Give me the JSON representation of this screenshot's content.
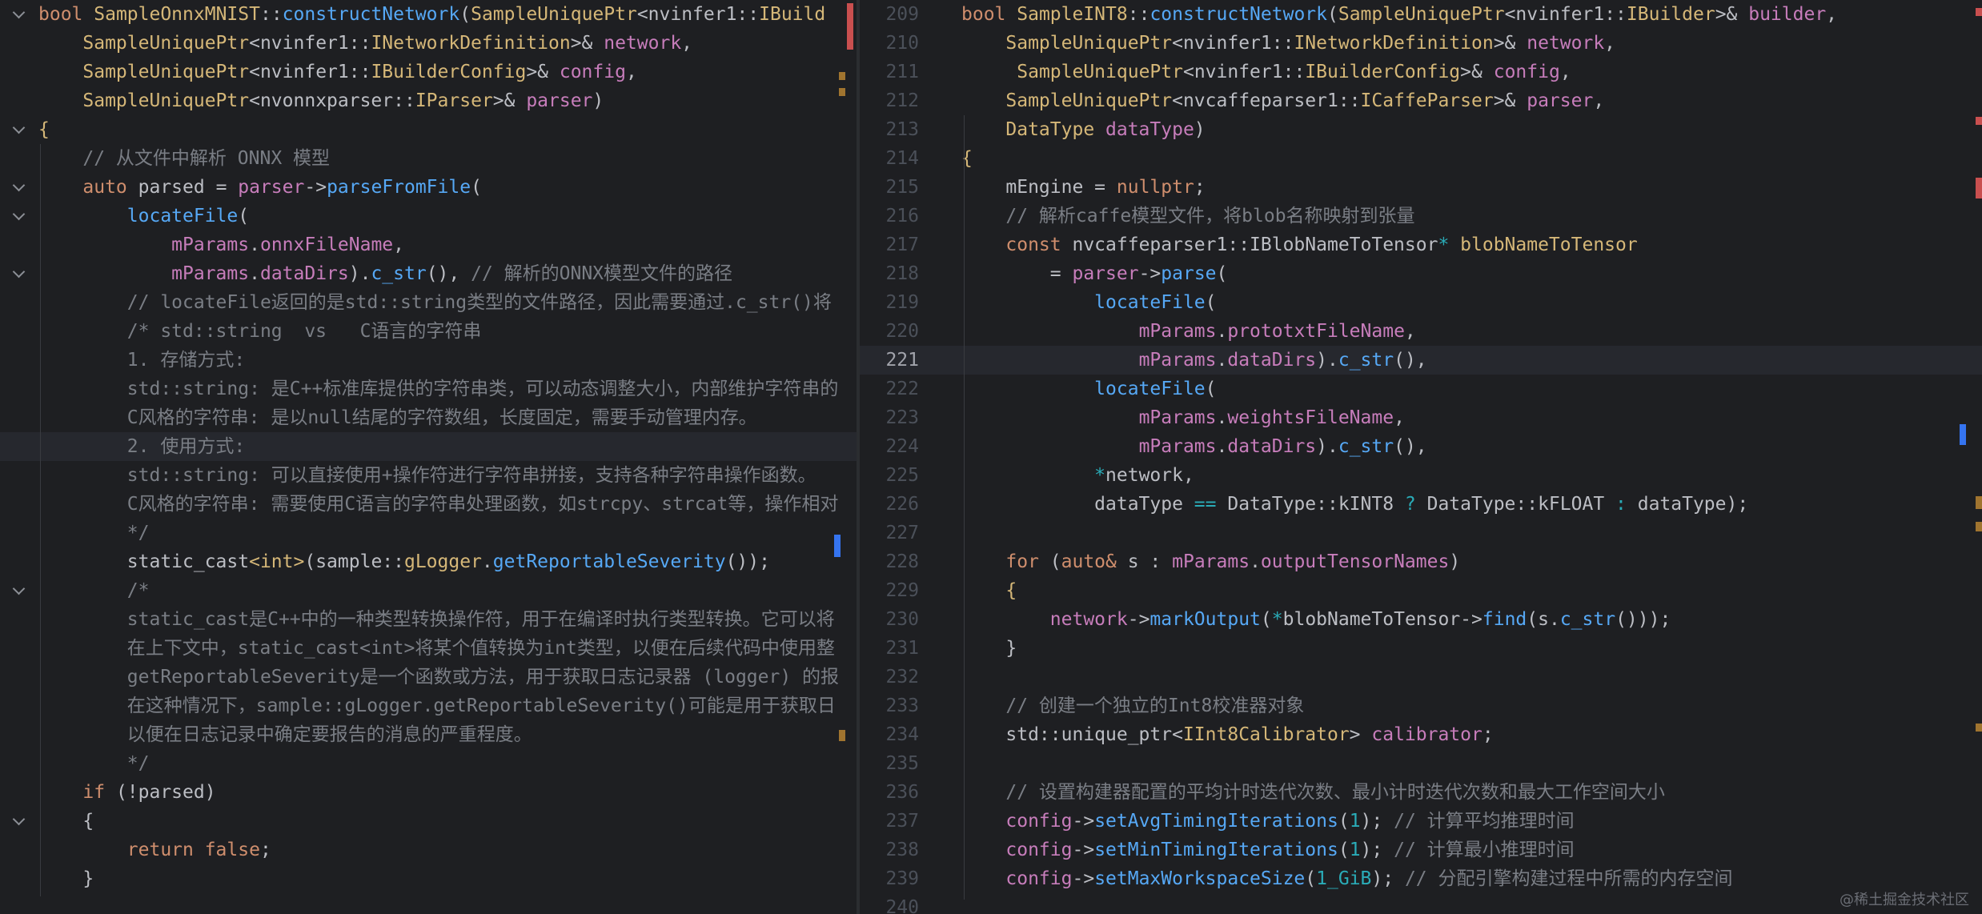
{
  "left_editor": {
    "lines": [
      {
        "fold": true,
        "indent": 0,
        "tokens": [
          [
            "kw",
            "bool "
          ],
          [
            "ty",
            "SampleOnnxMNIST"
          ],
          [
            "pl",
            "::"
          ],
          [
            "fn",
            "constructNetwork"
          ],
          [
            "pl",
            "("
          ],
          [
            "ty",
            "SampleUniquePtr"
          ],
          [
            "pl",
            "<nvinfer1::"
          ],
          [
            "ty",
            "IBuild"
          ]
        ]
      },
      {
        "indent": 1,
        "tokens": [
          [
            "ty",
            "SampleUniquePtr"
          ],
          [
            "pl",
            "<nvinfer1::"
          ],
          [
            "ty",
            "INetworkDefinition"
          ],
          [
            "pl",
            ">& "
          ],
          [
            "vr",
            "network"
          ],
          [
            "pl",
            ","
          ]
        ]
      },
      {
        "indent": 1,
        "tokens": [
          [
            "ty",
            "SampleUniquePtr"
          ],
          [
            "pl",
            "<nvinfer1::"
          ],
          [
            "ty",
            "IBuilderConfig"
          ],
          [
            "pl",
            ">& "
          ],
          [
            "vr",
            "config"
          ],
          [
            "pl",
            ","
          ]
        ]
      },
      {
        "indent": 1,
        "tokens": [
          [
            "ty",
            "SampleUniquePtr"
          ],
          [
            "pl",
            "<nvonnxparser::"
          ],
          [
            "ty",
            "IParser"
          ],
          [
            "pl",
            ">& "
          ],
          [
            "vr",
            "parser"
          ],
          [
            "pl",
            ")"
          ]
        ]
      },
      {
        "fold": true,
        "indent": 0,
        "tokens": [
          [
            "ty",
            "{"
          ]
        ]
      },
      {
        "indent": 1,
        "tokens": [
          [
            "cm",
            "// 从文件中解析 ONNX 模型"
          ]
        ]
      },
      {
        "fold": true,
        "indent": 1,
        "tokens": [
          [
            "kw",
            "auto "
          ],
          [
            "pl",
            "parsed = "
          ],
          [
            "vr",
            "parser"
          ],
          [
            "pl",
            "->"
          ],
          [
            "fn",
            "parseFromFile"
          ],
          [
            "pl",
            "("
          ]
        ]
      },
      {
        "fold": true,
        "indent": 2,
        "tokens": [
          [
            "fn",
            "locateFile"
          ],
          [
            "pl",
            "("
          ]
        ]
      },
      {
        "indent": 3,
        "tokens": [
          [
            "fd",
            "mParams"
          ],
          [
            "pl",
            "."
          ],
          [
            "fd",
            "onnxFileName"
          ],
          [
            "pl",
            ","
          ]
        ]
      },
      {
        "fold": true,
        "indent": 3,
        "tokens": [
          [
            "fd",
            "mParams"
          ],
          [
            "pl",
            "."
          ],
          [
            "fd",
            "dataDirs"
          ],
          [
            "pl",
            ")."
          ],
          [
            "fn",
            "c_str"
          ],
          [
            "pl",
            "(), "
          ],
          [
            "cm",
            "// 解析的ONNX模型文件的路径"
          ]
        ]
      },
      {
        "indent": 2,
        "tokens": [
          [
            "cm",
            "// locateFile返回的是std::string类型的文件路径，因此需要通过.c_str()将"
          ]
        ]
      },
      {
        "indent": 2,
        "tokens": [
          [
            "cm",
            "/* std::string  vs   C语言的字符串"
          ]
        ]
      },
      {
        "indent": 2,
        "tokens": [
          [
            "cm",
            "1. 存储方式:"
          ]
        ]
      },
      {
        "indent": 2,
        "tokens": [
          [
            "cm",
            "std::string: 是C++标准库提供的字符串类，可以动态调整大小，内部维护字符串的"
          ]
        ]
      },
      {
        "indent": 2,
        "tokens": [
          [
            "cm",
            "C风格的字符串: 是以null结尾的字符数组，长度固定，需要手动管理内存。"
          ]
        ]
      },
      {
        "indent": 2,
        "current": true,
        "tokens": [
          [
            "cm",
            "2. 使用方式:"
          ]
        ]
      },
      {
        "indent": 2,
        "tokens": [
          [
            "cm",
            "std::string: 可以直接使用+操作符进行字符串拼接，支持各种字符串操作函数。"
          ]
        ]
      },
      {
        "indent": 2,
        "tokens": [
          [
            "cm",
            "C风格的字符串: 需要使用C语言的字符串处理函数，如strcpy、strcat等，操作相对"
          ]
        ]
      },
      {
        "indent": 2,
        "tokens": [
          [
            "cm",
            "*/"
          ]
        ]
      },
      {
        "indent": 2,
        "tokens": [
          [
            "pl",
            "static_cast"
          ],
          [
            "ty",
            "<int>"
          ],
          [
            "pl",
            "(sample::"
          ],
          [
            "ty",
            "gLogger"
          ],
          [
            "pl",
            "."
          ],
          [
            "fn",
            "getReportableSeverity"
          ],
          [
            "pl",
            "());"
          ]
        ]
      },
      {
        "fold": true,
        "indent": 2,
        "tokens": [
          [
            "cm",
            "/*"
          ]
        ]
      },
      {
        "indent": 2,
        "tokens": [
          [
            "cm",
            "static_cast是C++中的一种类型转换操作符，用于在编译时执行类型转换。它可以将"
          ]
        ]
      },
      {
        "indent": 2,
        "tokens": [
          [
            "cm",
            "在上下文中，static_cast<int>将某个值转换为int类型，以便在后续代码中使用整"
          ]
        ]
      },
      {
        "indent": 2,
        "tokens": [
          [
            "cm",
            "getReportableSeverity是一个函数或方法，用于获取日志记录器 (logger) 的报"
          ]
        ]
      },
      {
        "indent": 2,
        "tokens": [
          [
            "cm",
            "在这种情况下，sample::gLogger.getReportableSeverity()可能是用于获取日"
          ]
        ]
      },
      {
        "indent": 2,
        "tokens": [
          [
            "cm",
            "以便在日志记录中确定要报告的消息的严重程度。"
          ]
        ]
      },
      {
        "indent": 2,
        "tokens": [
          [
            "cm",
            "*/"
          ]
        ]
      },
      {
        "indent": 1,
        "tokens": [
          [
            "kw",
            "if "
          ],
          [
            "pl",
            "(!parsed)"
          ]
        ]
      },
      {
        "fold": true,
        "indent": 1,
        "tokens": [
          [
            "pl",
            "{"
          ]
        ]
      },
      {
        "indent": 2,
        "tokens": [
          [
            "kw",
            "return false"
          ],
          [
            "pl",
            ";"
          ]
        ]
      },
      {
        "indent": 1,
        "tokens": [
          [
            "pl",
            "}"
          ]
        ]
      }
    ]
  },
  "right_editor": {
    "lines": [
      {
        "num": "209",
        "indent": 0,
        "tokens": [
          [
            "kw",
            "bool "
          ],
          [
            "ty",
            "SampleINT8"
          ],
          [
            "pl",
            "::"
          ],
          [
            "fn",
            "constructNetwork"
          ],
          [
            "pl",
            "("
          ],
          [
            "ty",
            "SampleUniquePtr"
          ],
          [
            "pl",
            "<nvinfer1::"
          ],
          [
            "ty",
            "IBuilder"
          ],
          [
            "pl",
            ">& "
          ],
          [
            "vr",
            "builder"
          ],
          [
            "pl",
            ","
          ]
        ]
      },
      {
        "num": "210",
        "indent": 1,
        "tokens": [
          [
            "ty",
            "SampleUniquePtr"
          ],
          [
            "pl",
            "<nvinfer1::"
          ],
          [
            "ty",
            "INetworkDefinition"
          ],
          [
            "pl",
            ">& "
          ],
          [
            "vr",
            "network"
          ],
          [
            "pl",
            ","
          ]
        ]
      },
      {
        "num": "211",
        "indent": 1,
        "tokens": [
          [
            "pl",
            " "
          ],
          [
            "ty",
            "SampleUniquePtr"
          ],
          [
            "pl",
            "<nvinfer1::"
          ],
          [
            "ty",
            "IBuilderConfig"
          ],
          [
            "pl",
            ">& "
          ],
          [
            "vr",
            "config"
          ],
          [
            "pl",
            ","
          ]
        ]
      },
      {
        "num": "212",
        "indent": 1,
        "tokens": [
          [
            "ty",
            "SampleUniquePtr"
          ],
          [
            "pl",
            "<nvcaffeparser1::"
          ],
          [
            "ty",
            "ICaffeParser"
          ],
          [
            "pl",
            ">& "
          ],
          [
            "vr",
            "parser"
          ],
          [
            "pl",
            ","
          ]
        ]
      },
      {
        "num": "213",
        "indent": 1,
        "tokens": [
          [
            "ty",
            "DataType "
          ],
          [
            "vr",
            "dataType"
          ],
          [
            "pl",
            ")"
          ]
        ]
      },
      {
        "num": "214",
        "indent": 0,
        "tokens": [
          [
            "ty",
            "{"
          ]
        ]
      },
      {
        "num": "215",
        "indent": 1,
        "tokens": [
          [
            "pl",
            "mEngine = "
          ],
          [
            "kw",
            "nullptr"
          ],
          [
            "pl",
            ";"
          ]
        ]
      },
      {
        "num": "216",
        "indent": 1,
        "tokens": [
          [
            "cm",
            "// 解析caffe模型文件，将blob名称映射到张量"
          ]
        ]
      },
      {
        "num": "217",
        "indent": 1,
        "tokens": [
          [
            "kw",
            "const "
          ],
          [
            "pl",
            "nvcaffeparser1::IBlobNameToTensor"
          ],
          [
            "nu",
            "* "
          ],
          [
            "ty",
            "blobNameToTensor"
          ]
        ]
      },
      {
        "num": "218",
        "indent": 2,
        "tokens": [
          [
            "pl",
            "= "
          ],
          [
            "vr",
            "parser"
          ],
          [
            "pl",
            "->"
          ],
          [
            "fn",
            "parse"
          ],
          [
            "pl",
            "("
          ]
        ]
      },
      {
        "num": "219",
        "indent": 3,
        "tokens": [
          [
            "fn",
            "locateFile"
          ],
          [
            "pl",
            "("
          ]
        ]
      },
      {
        "num": "220",
        "indent": 4,
        "tokens": [
          [
            "fd",
            "mParams"
          ],
          [
            "pl",
            "."
          ],
          [
            "fd",
            "prototxtFileName"
          ],
          [
            "pl",
            ","
          ]
        ]
      },
      {
        "num": "221",
        "indent": 4,
        "current": true,
        "tokens": [
          [
            "fd",
            "mParams"
          ],
          [
            "pl",
            "."
          ],
          [
            "fd",
            "dataDirs"
          ],
          [
            "pl",
            ")."
          ],
          [
            "fn",
            "c_str"
          ],
          [
            "pl",
            "(),"
          ]
        ]
      },
      {
        "num": "222",
        "indent": 3,
        "tokens": [
          [
            "fn",
            "locateFile"
          ],
          [
            "pl",
            "("
          ]
        ]
      },
      {
        "num": "223",
        "indent": 4,
        "tokens": [
          [
            "fd",
            "mParams"
          ],
          [
            "pl",
            "."
          ],
          [
            "fd",
            "weightsFileName"
          ],
          [
            "pl",
            ","
          ]
        ]
      },
      {
        "num": "224",
        "indent": 4,
        "tokens": [
          [
            "fd",
            "mParams"
          ],
          [
            "pl",
            "."
          ],
          [
            "fd",
            "dataDirs"
          ],
          [
            "pl",
            ")."
          ],
          [
            "fn",
            "c_str"
          ],
          [
            "pl",
            "(),"
          ]
        ]
      },
      {
        "num": "225",
        "indent": 3,
        "tokens": [
          [
            "nu",
            "*"
          ],
          [
            "pl",
            "network,"
          ]
        ]
      },
      {
        "num": "226",
        "indent": 3,
        "tokens": [
          [
            "pl",
            "dataType "
          ],
          [
            "nu",
            "=="
          ],
          [
            "pl",
            " DataType::kINT8 "
          ],
          [
            "nu",
            "?"
          ],
          [
            "pl",
            " DataType::kFLOAT "
          ],
          [
            "nu",
            ":"
          ],
          [
            "pl",
            " dataType);"
          ]
        ]
      },
      {
        "num": "227",
        "indent": 0,
        "tokens": []
      },
      {
        "num": "228",
        "indent": 1,
        "tokens": [
          [
            "kw",
            "for "
          ],
          [
            "pl",
            "("
          ],
          [
            "kw",
            "auto& "
          ],
          [
            "pl",
            "s : "
          ],
          [
            "fd",
            "mParams"
          ],
          [
            "pl",
            "."
          ],
          [
            "fd",
            "outputTensorNames"
          ],
          [
            "pl",
            ")"
          ]
        ]
      },
      {
        "num": "229",
        "indent": 1,
        "tokens": [
          [
            "ty",
            "{"
          ]
        ]
      },
      {
        "num": "230",
        "indent": 2,
        "tokens": [
          [
            "vr",
            "network"
          ],
          [
            "pl",
            "->"
          ],
          [
            "fn",
            "markOutput"
          ],
          [
            "pl",
            "("
          ],
          [
            "nu",
            "*"
          ],
          [
            "pl",
            "blobNameToTensor->"
          ],
          [
            "fn",
            "find"
          ],
          [
            "pl",
            "(s."
          ],
          [
            "fn",
            "c_str"
          ],
          [
            "pl",
            "()));"
          ]
        ]
      },
      {
        "num": "231",
        "indent": 1,
        "tokens": [
          [
            "pl",
            "}"
          ]
        ]
      },
      {
        "num": "232",
        "indent": 0,
        "tokens": []
      },
      {
        "num": "233",
        "indent": 1,
        "tokens": [
          [
            "cm",
            "// 创建一个独立的Int8校准器对象"
          ]
        ]
      },
      {
        "num": "234",
        "indent": 1,
        "tokens": [
          [
            "pl",
            "std::unique_ptr<"
          ],
          [
            "ty",
            "IInt8Calibrator"
          ],
          [
            "pl",
            "> "
          ],
          [
            "vr",
            "calibrator"
          ],
          [
            "pl",
            ";"
          ]
        ]
      },
      {
        "num": "235",
        "indent": 0,
        "tokens": []
      },
      {
        "num": "236",
        "indent": 1,
        "tokens": [
          [
            "cm",
            "// 设置构建器配置的平均计时迭代次数、最小计时迭代次数和最大工作空间大小"
          ]
        ]
      },
      {
        "num": "237",
        "indent": 1,
        "tokens": [
          [
            "vr",
            "config"
          ],
          [
            "pl",
            "->"
          ],
          [
            "fn",
            "setAvgTimingIterations"
          ],
          [
            "pl",
            "("
          ],
          [
            "nu",
            "1"
          ],
          [
            "pl",
            "); "
          ],
          [
            "cm",
            "// 计算平均推理时间"
          ]
        ]
      },
      {
        "num": "238",
        "indent": 1,
        "tokens": [
          [
            "vr",
            "config"
          ],
          [
            "pl",
            "->"
          ],
          [
            "fn",
            "setMinTimingIterations"
          ],
          [
            "pl",
            "("
          ],
          [
            "nu",
            "1"
          ],
          [
            "pl",
            "); "
          ],
          [
            "cm",
            "// 计算最小推理时间"
          ]
        ]
      },
      {
        "num": "239",
        "indent": 1,
        "tokens": [
          [
            "vr",
            "config"
          ],
          [
            "pl",
            "->"
          ],
          [
            "fn",
            "setMaxWorkspaceSize"
          ],
          [
            "pl",
            "("
          ],
          [
            "nu",
            "1_GiB"
          ],
          [
            "pl",
            "); "
          ],
          [
            "cm",
            "// 分配引擎构建过程中所需的内存空间"
          ]
        ]
      },
      {
        "num": "240",
        "indent": 0,
        "tokens": []
      }
    ]
  },
  "watermark": "@稀土掘金技术社区"
}
